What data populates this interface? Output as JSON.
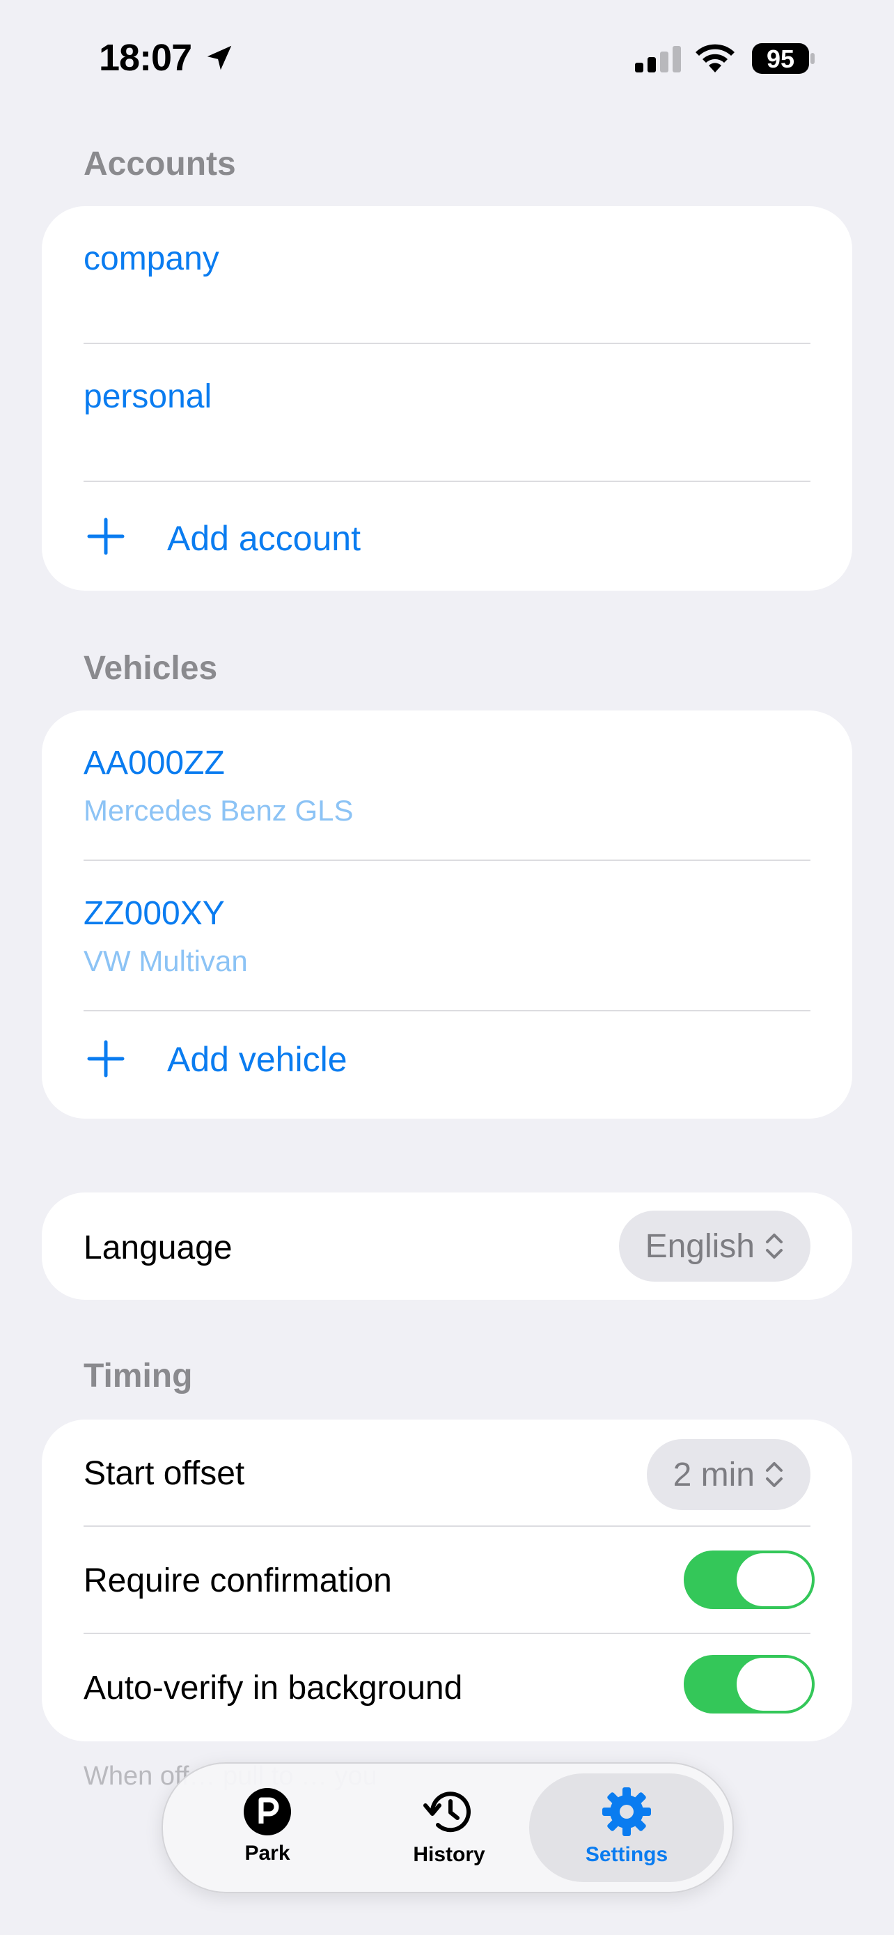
{
  "status_bar": {
    "time": "18:07",
    "battery": "95"
  },
  "accounts": {
    "header": "Accounts",
    "items": [
      {
        "label": "company"
      },
      {
        "label": "personal"
      }
    ],
    "add_label": "Add account"
  },
  "vehicles": {
    "header": "Vehicles",
    "items": [
      {
        "plate": "AA000ZZ",
        "model": "Mercedes Benz GLS"
      },
      {
        "plate": "ZZ000XY",
        "model": "VW Multivan"
      }
    ],
    "add_label": "Add vehicle"
  },
  "language": {
    "label": "Language",
    "value": "English"
  },
  "timing": {
    "header": "Timing",
    "start_offset_label": "Start offset",
    "start_offset_value": "2 min",
    "require_confirmation_label": "Require confirmation",
    "require_confirmation_on": true,
    "auto_verify_label": "Auto-verify in background",
    "auto_verify_on": true
  },
  "footer_note": "When off… pull to … you",
  "tabs": [
    {
      "label": "Park",
      "icon": "parking-icon",
      "selected": false
    },
    {
      "label": "History",
      "icon": "history-icon",
      "selected": false
    },
    {
      "label": "Settings",
      "icon": "gear-icon",
      "selected": true
    }
  ],
  "colors": {
    "accent": "#0a7cf0",
    "toggle_on": "#34c759",
    "background": "#f0f0f5"
  }
}
